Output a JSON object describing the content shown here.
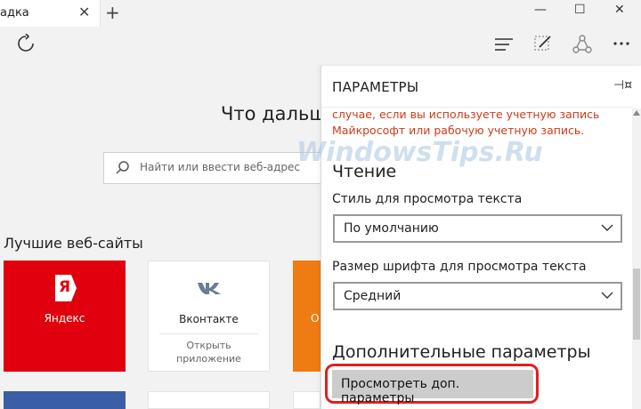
{
  "tab": {
    "title": "адка"
  },
  "newtab_label": "+",
  "window_buttons": {
    "min": "—",
    "max": "☐",
    "close": "✕"
  },
  "page": {
    "heading": "Что дальш",
    "search_placeholder": "Найти или ввести веб-адрес",
    "section_title": "Лучшие веб-сайты",
    "tiles": [
      {
        "name": "Яндекс",
        "icon": "Я",
        "color": "#e0000e"
      },
      {
        "name": "Вконтакте",
        "icon": "vk",
        "sub1": "Открыть",
        "sub2": "приложение"
      },
      {
        "name": "О",
        "color": "#ef7b13"
      }
    ]
  },
  "settings": {
    "title": "ПАРАМЕТРЫ",
    "warn_line1": "случае, если вы используете учетную запись",
    "warn_line2": "Майкрософт или рабочую учетную запись.",
    "watermark": "WindowsTips.Ru",
    "reading_heading": "Чтение",
    "style_label": "Стиль для просмотра текста",
    "style_value": "По умолчанию",
    "size_label": "Размер шрифта для просмотра текста",
    "size_value": "Средний",
    "advanced_heading": "Дополнительные параметры",
    "advanced_button": "Просмотреть доп. параметры"
  },
  "colors": {
    "accent_red": "#e02020",
    "warn": "#cf3b16",
    "yandex_red": "#e0000e",
    "orange": "#ef7b13"
  }
}
